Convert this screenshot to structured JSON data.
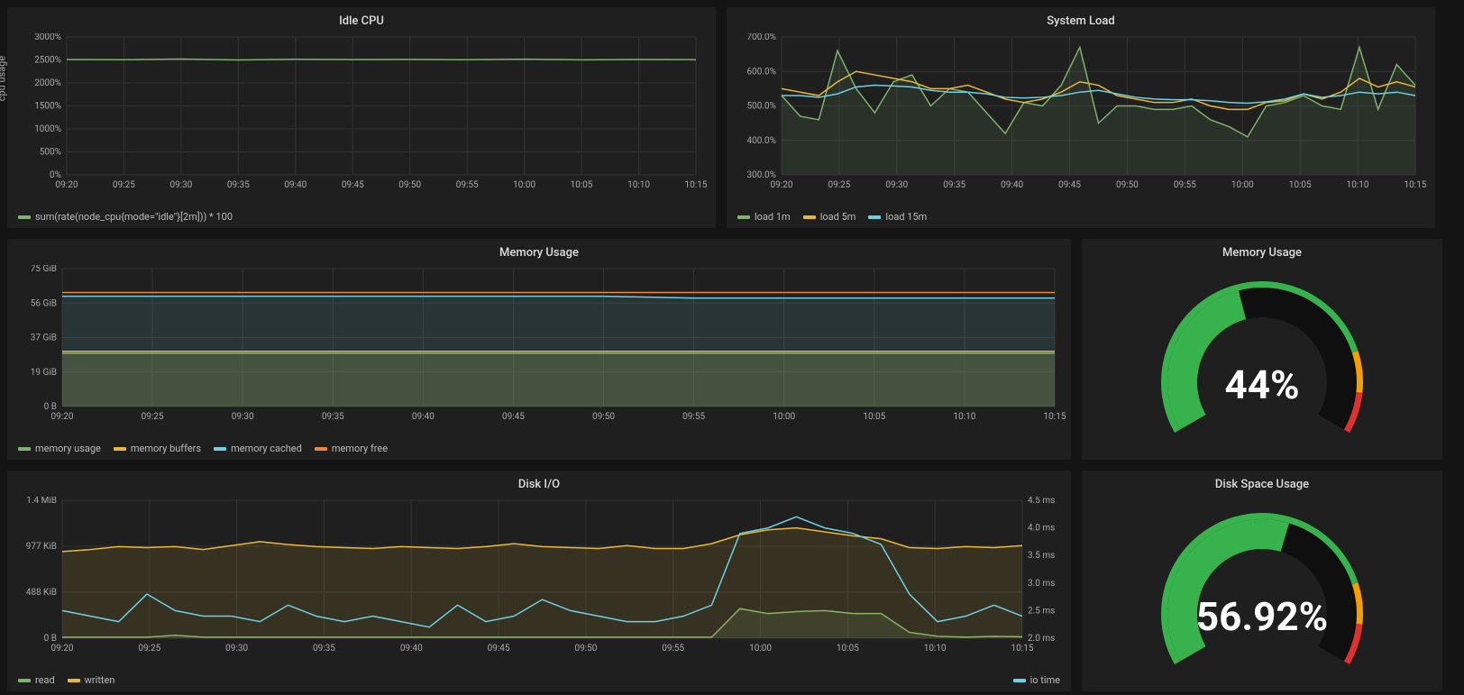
{
  "chart_data": [
    {
      "id": "idle_cpu",
      "type": "line",
      "title": "Idle CPU",
      "ylabel": "cpu usage",
      "xlabel": "",
      "ylim": [
        0,
        3000
      ],
      "yticks": [
        "0%",
        "500%",
        "1000%",
        "1500%",
        "2000%",
        "2500%",
        "3000%"
      ],
      "x_ticks": [
        "09:20",
        "09:25",
        "09:30",
        "09:35",
        "09:40",
        "09:45",
        "09:50",
        "09:55",
        "10:00",
        "10:05",
        "10:10",
        "10:15"
      ],
      "series": [
        {
          "name": "sum(rate(node_cpu{mode=\"idle\"}[2m])) * 100",
          "color": "#7EB26D",
          "values": [
            2510,
            2505,
            2520,
            2500,
            2515,
            2508,
            2512,
            2505,
            2518,
            2502,
            2510,
            2506
          ]
        }
      ]
    },
    {
      "id": "system_load",
      "type": "line",
      "title": "System Load",
      "xlabel": "",
      "ylabel": "",
      "ylim": [
        300,
        700
      ],
      "yticks": [
        "300.0%",
        "400.0%",
        "500.0%",
        "600.0%",
        "700.0%"
      ],
      "x_ticks": [
        "09:20",
        "09:25",
        "09:30",
        "09:35",
        "09:40",
        "09:45",
        "09:50",
        "09:55",
        "10:00",
        "10:05",
        "10:10",
        "10:15"
      ],
      "series": [
        {
          "name": "load 1m",
          "color": "#7EB26D",
          "fill": true,
          "values": [
            530,
            470,
            460,
            660,
            550,
            480,
            570,
            590,
            500,
            550,
            540,
            480,
            420,
            510,
            500,
            560,
            670,
            450,
            500,
            500,
            490,
            490,
            500,
            460,
            440,
            410,
            500,
            510,
            530,
            500,
            490,
            670,
            490,
            620,
            560
          ]
        },
        {
          "name": "load 5m",
          "color": "#EAB839",
          "values": [
            550,
            540,
            530,
            570,
            600,
            590,
            580,
            570,
            550,
            550,
            560,
            540,
            520,
            510,
            520,
            540,
            570,
            560,
            530,
            520,
            510,
            510,
            520,
            500,
            490,
            490,
            510,
            515,
            535,
            520,
            540,
            580,
            555,
            570,
            555
          ]
        },
        {
          "name": "load 15m",
          "color": "#6ED0E0",
          "values": [
            530,
            530,
            525,
            535,
            555,
            560,
            558,
            555,
            545,
            540,
            540,
            535,
            525,
            523,
            525,
            530,
            540,
            545,
            535,
            525,
            520,
            518,
            518,
            515,
            510,
            508,
            512,
            520,
            535,
            525,
            530,
            540,
            535,
            540,
            530
          ]
        }
      ]
    },
    {
      "id": "memory_usage_ts",
      "type": "line",
      "title": "Memory Usage",
      "xlabel": "",
      "ylabel": "",
      "ylim": [
        0,
        75
      ],
      "yticks": [
        "0 B",
        "19 GiB",
        "37 GiB",
        "56 GiB",
        "75 GiB"
      ],
      "x_ticks": [
        "09:20",
        "09:25",
        "09:30",
        "09:35",
        "09:40",
        "09:45",
        "09:50",
        "09:55",
        "10:00",
        "10:05",
        "10:10",
        "10:15"
      ],
      "series": [
        {
          "name": "memory usage",
          "color": "#7EB26D",
          "fill": true,
          "values": [
            29,
            29,
            29,
            29,
            29,
            29,
            29,
            29,
            29,
            29,
            29,
            29
          ]
        },
        {
          "name": "memory buffers",
          "color": "#EAB839",
          "fill": true,
          "values": [
            30,
            30,
            30,
            30,
            30,
            30,
            30,
            30,
            30,
            30,
            30,
            30
          ]
        },
        {
          "name": "memory cached",
          "color": "#6ED0E0",
          "fill": true,
          "values": [
            60,
            60,
            60,
            60,
            60,
            60,
            60,
            59,
            59,
            59,
            59,
            59
          ]
        },
        {
          "name": "memory free",
          "color": "#EF843C",
          "values": [
            62,
            62,
            62,
            62,
            62,
            62,
            62,
            62,
            62,
            62,
            62,
            62
          ]
        }
      ]
    },
    {
      "id": "memory_gauge",
      "type": "gauge",
      "title": "Memory Usage",
      "value": 44,
      "display": "44%",
      "min": 0,
      "max": 100,
      "thresholds": [
        0,
        80,
        90,
        100
      ],
      "colors": [
        "#37b24d",
        "#f59f00",
        "#e03131"
      ]
    },
    {
      "id": "disk_io",
      "type": "line",
      "title": "Disk I/O",
      "xlabel": "",
      "ylabel": "",
      "ylim": [
        0,
        1400
      ],
      "yticks": [
        "0 B",
        "488 KiB",
        "977 KiB",
        "1.4 MiB"
      ],
      "y2lim": [
        2.0,
        4.5
      ],
      "y2ticks": [
        "2.0 ms",
        "2.5 ms",
        "3.0 ms",
        "3.5 ms",
        "4.0 ms",
        "4.5 ms"
      ],
      "x_ticks": [
        "09:20",
        "09:25",
        "09:30",
        "09:35",
        "09:40",
        "09:45",
        "09:50",
        "09:55",
        "10:00",
        "10:05",
        "10:10",
        "10:15"
      ],
      "series": [
        {
          "name": "read",
          "color": "#7EB26D",
          "fill": true,
          "values": [
            10,
            10,
            10,
            10,
            30,
            10,
            10,
            10,
            10,
            10,
            10,
            10,
            10,
            10,
            10,
            10,
            10,
            10,
            10,
            10,
            10,
            10,
            10,
            10,
            300,
            250,
            270,
            280,
            250,
            250,
            60,
            20,
            10,
            20,
            15
          ]
        },
        {
          "name": "written",
          "color": "#EAB839",
          "fill": true,
          "values": [
            880,
            900,
            930,
            920,
            930,
            900,
            940,
            980,
            950,
            930,
            920,
            910,
            930,
            920,
            910,
            930,
            960,
            930,
            920,
            910,
            940,
            910,
            910,
            960,
            1050,
            1100,
            1120,
            1080,
            1040,
            1010,
            920,
            910,
            930,
            920,
            940
          ]
        },
        {
          "name": "io time",
          "color": "#6ED0E0",
          "axis": "y2",
          "values": [
            2.5,
            2.4,
            2.3,
            2.8,
            2.5,
            2.4,
            2.4,
            2.3,
            2.6,
            2.4,
            2.3,
            2.4,
            2.3,
            2.2,
            2.6,
            2.3,
            2.4,
            2.7,
            2.5,
            2.4,
            2.3,
            2.3,
            2.4,
            2.6,
            3.9,
            4.0,
            4.2,
            4.0,
            3.9,
            3.7,
            2.8,
            2.3,
            2.4,
            2.6,
            2.4
          ]
        }
      ]
    },
    {
      "id": "disk_gauge",
      "type": "gauge",
      "title": "Disk Space Usage",
      "value": 56.92,
      "display": "56.92%",
      "min": 0,
      "max": 100,
      "thresholds": [
        0,
        80,
        90,
        100
      ],
      "colors": [
        "#37b24d",
        "#f59f00",
        "#e03131"
      ]
    }
  ]
}
